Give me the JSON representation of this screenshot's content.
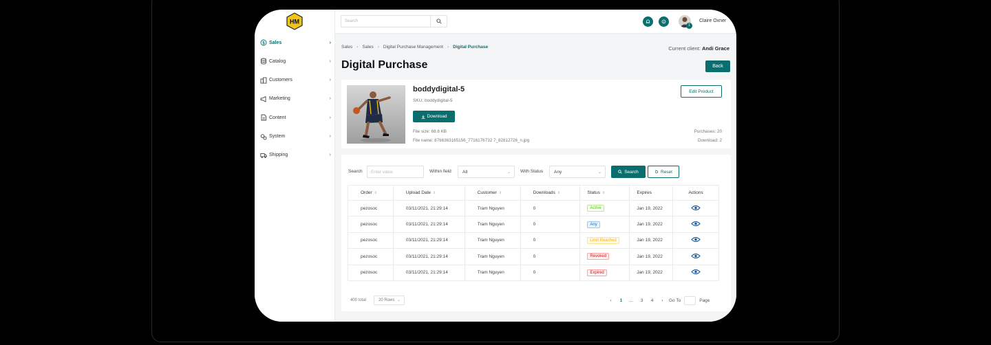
{
  "brand": {
    "logo_text": "HM"
  },
  "sidebar": {
    "items": [
      {
        "label": "Sales",
        "icon": "dollar-circle-icon"
      },
      {
        "label": "Catalog",
        "icon": "database-icon"
      },
      {
        "label": "Customers",
        "icon": "building-icon"
      },
      {
        "label": "Marketing",
        "icon": "megaphone-icon"
      },
      {
        "label": "Content",
        "icon": "document-icon"
      },
      {
        "label": "System",
        "icon": "gears-icon"
      },
      {
        "label": "Shipping",
        "icon": "truck-icon"
      }
    ]
  },
  "topbar": {
    "search_placeholder": "Search",
    "notification_badge": "1",
    "user_name": "Claire Oxner"
  },
  "breadcrumb": [
    "Sales",
    "Sales",
    "Digital Purchase Management",
    "Digital Purchase"
  ],
  "client": {
    "label": "Current client:",
    "name": "Andi Grace"
  },
  "page": {
    "title": "Digital Purchase",
    "back_label": "Back"
  },
  "product": {
    "name": "boddydigital-5",
    "sku": "SKU: boddydigital-5",
    "download_label": "Download",
    "file_size": "File size: 68.6 KB",
    "file_name": "File name: 8766363165156_7716176732 7_82812726_n.jpg",
    "edit_label": "Edit Product",
    "purchases": "Purchases: 20",
    "downloads": "Download: 2"
  },
  "filters": {
    "search_label": "Search",
    "search_placeholder": "Enter value",
    "within_label": "Within field",
    "within_value": "All",
    "status_label": "With Status",
    "status_value": "Any",
    "search_button": "Search",
    "reset_button": "Reset"
  },
  "table": {
    "headers": [
      "Order",
      "Upload Date",
      "Customer",
      "Downloads",
      "Status",
      "Expires",
      "Actions"
    ],
    "rows": [
      {
        "order": "pezosoc",
        "date": "03/11/2021, 21:29:14",
        "customer": "Tram Nguyen",
        "downloads": "0",
        "status": "Active",
        "expires": "Jan 19, 2022"
      },
      {
        "order": "pezosoc",
        "date": "03/11/2021, 21:29:14",
        "customer": "Tram Nguyen",
        "downloads": "0",
        "status": "Any",
        "expires": "Jan 19, 2022"
      },
      {
        "order": "pezosoc",
        "date": "03/11/2021, 21:29:14",
        "customer": "Tram Nguyen",
        "downloads": "0",
        "status": "Limit Reached",
        "expires": "Jan 19, 2022"
      },
      {
        "order": "pezosoc",
        "date": "03/11/2021, 21:29:14",
        "customer": "Tram Nguyen",
        "downloads": "0",
        "status": "Revoked",
        "expires": "Jan 19, 2022"
      },
      {
        "order": "pezosoc",
        "date": "03/11/2021, 21:29:14",
        "customer": "Tram Nguyen",
        "downloads": "0",
        "status": "Expired",
        "expires": "Jan 19, 2022"
      }
    ],
    "status_colors": {
      "Active": {
        "fg": "#52c41a",
        "bg": "#f6ffed",
        "border": "#b7eb8f"
      },
      "Any": {
        "fg": "#1d6fa5",
        "bg": "#e6f4ff",
        "border": "#91caff"
      },
      "Limit Reached": {
        "fg": "#faad14",
        "bg": "#fffbe6",
        "border": "#ffe58f"
      },
      "Revoked": {
        "fg": "#cf1322",
        "bg": "#fff1f0",
        "border": "#ffa39e"
      },
      "Expired": {
        "fg": "#cf1322",
        "bg": "#fff1f0",
        "border": "#ffa39e"
      }
    }
  },
  "pagination": {
    "total": "400 total",
    "rows_per_page": "20 Rows",
    "pages": [
      "1",
      "...",
      "3",
      "4"
    ],
    "current": "1",
    "goto_label": "Go To",
    "page_label": "Page"
  },
  "colors": {
    "accent": "#0b6e6e"
  }
}
